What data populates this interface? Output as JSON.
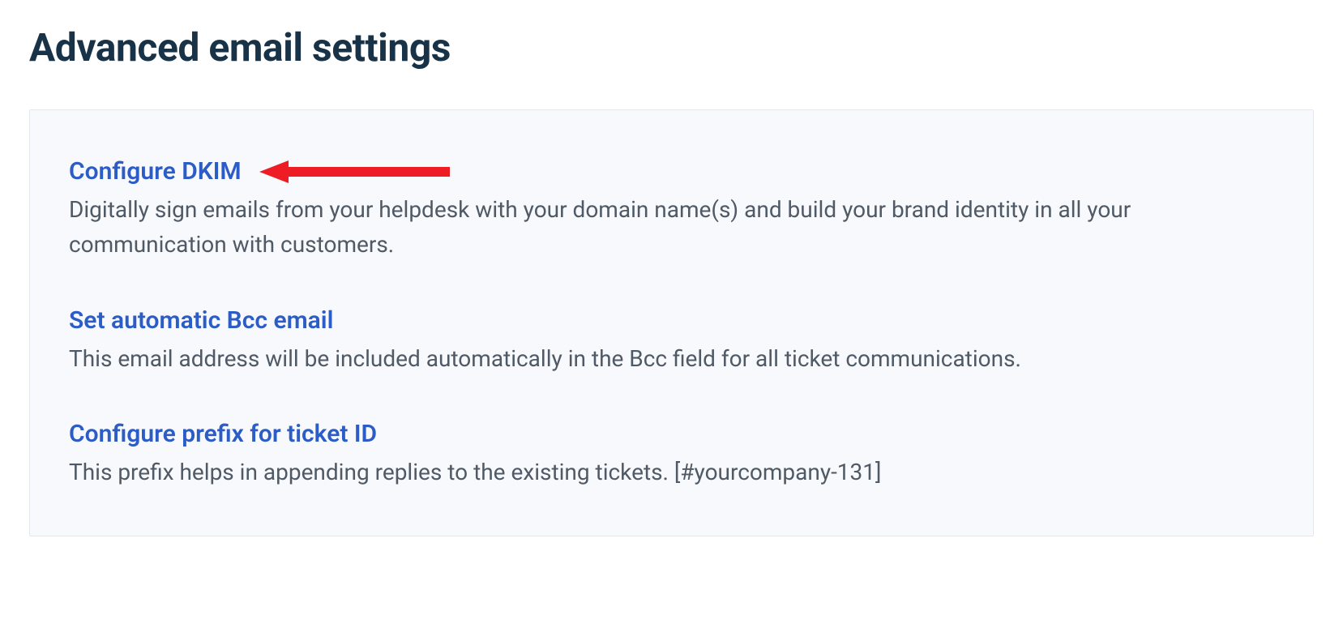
{
  "header": {
    "title": "Advanced email settings"
  },
  "settings": [
    {
      "title": "Configure DKIM",
      "description": "Digitally sign emails from your helpdesk with your domain name(s) and build your brand identity in all your communication with customers.",
      "highlighted": true
    },
    {
      "title": "Set automatic Bcc email",
      "description": "This email address will be included automatically in the Bcc field for all ticket communications.",
      "highlighted": false
    },
    {
      "title": "Configure prefix for ticket ID",
      "description": "This prefix helps in appending replies to the existing tickets. [#yourcompany-131]",
      "highlighted": false
    }
  ],
  "annotation": {
    "arrow_color": "#ee1c25"
  }
}
